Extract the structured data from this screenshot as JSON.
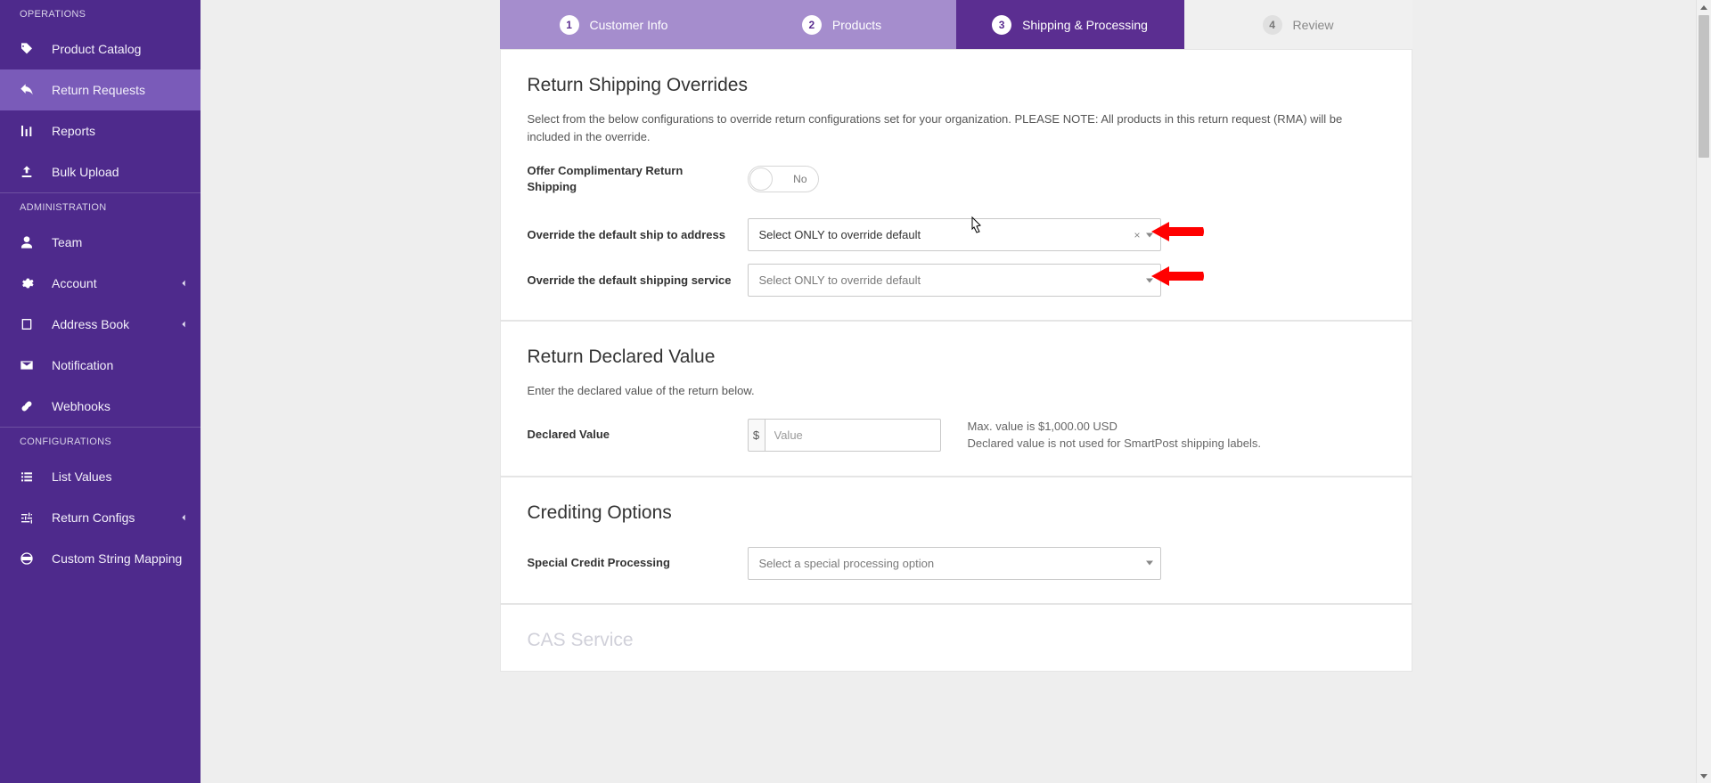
{
  "sidebar": {
    "sections": {
      "operations": "OPERATIONS",
      "administration": "ADMINISTRATION",
      "configurations": "CONFIGURATIONS"
    },
    "items": {
      "product_catalog": "Product Catalog",
      "return_requests": "Return Requests",
      "reports": "Reports",
      "bulk_upload": "Bulk Upload",
      "team": "Team",
      "account": "Account",
      "address_book": "Address Book",
      "notification": "Notification",
      "webhooks": "Webhooks",
      "list_values": "List Values",
      "return_configs": "Return Configs",
      "custom_string_mapping": "Custom String Mapping"
    }
  },
  "stepper": {
    "s1": {
      "num": "1",
      "label": "Customer Info"
    },
    "s2": {
      "num": "2",
      "label": "Products"
    },
    "s3": {
      "num": "3",
      "label": "Shipping & Processing"
    },
    "s4": {
      "num": "4",
      "label": "Review"
    }
  },
  "panels": {
    "overrides": {
      "title": "Return Shipping Overrides",
      "desc": "Select from the below configurations to override return configurations set for your organization. PLEASE NOTE: All products in this return request (RMA) will be included in the override.",
      "row_comp_label": "Offer Complimentary Return Shipping",
      "toggle_state": "No",
      "row_addr_label": "Override the default ship to address",
      "addr_select_text": "Select ONLY to override default",
      "row_svc_label": "Override the default shipping service",
      "svc_select_placeholder": "Select ONLY to override default"
    },
    "declared": {
      "title": "Return Declared Value",
      "desc": "Enter the declared value of the return below.",
      "row_label": "Declared Value",
      "currency": "$",
      "value_placeholder": "Value",
      "note1": "Max. value is $1,000.00 USD",
      "note2": "Declared value is not used for SmartPost shipping labels."
    },
    "credit": {
      "title": "Crediting Options",
      "row_label": "Special Credit Processing",
      "select_placeholder": "Select a special processing option"
    },
    "cas": {
      "title": "CAS Service"
    }
  },
  "arrow_color": "#ff0000"
}
